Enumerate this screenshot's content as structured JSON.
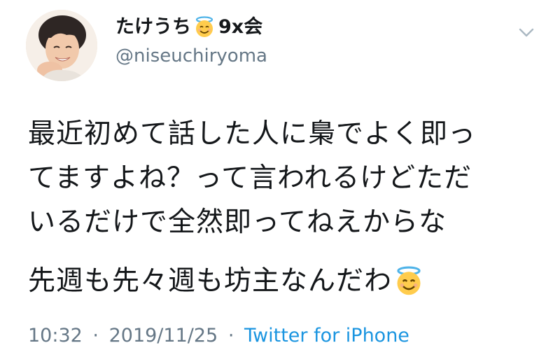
{
  "user": {
    "display_name": "たけうち",
    "name_suffix": "9x会",
    "handle": "@niseuchiryoma",
    "emoji_icon": "smiling-face-with-halo-icon"
  },
  "tweet": {
    "lines": [
      "最近初めて話した人に梟でよく即っ",
      "てますよね？って言われるけどただ",
      "いるだけで全然即ってねえからな"
    ],
    "line2": "先週も先々週も坊主なんだわ"
  },
  "meta": {
    "time": "10:32",
    "date": "2019/11/25",
    "separator": "·",
    "source": "Twitter for iPhone"
  },
  "colors": {
    "text": "#14171a",
    "secondary": "#657786",
    "link": "#1b95e0"
  },
  "icons": {
    "menu": "chevron-down-icon"
  }
}
